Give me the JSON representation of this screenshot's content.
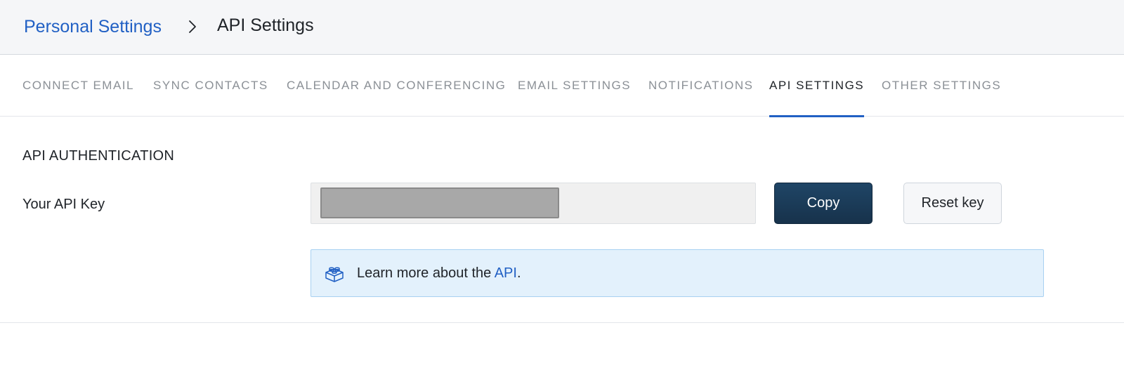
{
  "breadcrumb": {
    "parent": "Personal Settings",
    "separator_icon": "chevron-right-icon",
    "current": "API Settings"
  },
  "tabs": [
    {
      "label": "CONNECT EMAIL",
      "active": false
    },
    {
      "label": "SYNC CONTACTS",
      "active": false
    },
    {
      "label": "CALENDAR AND CONFERENCING",
      "active": false
    },
    {
      "label": "EMAIL SETTINGS",
      "active": false
    },
    {
      "label": "NOTIFICATIONS",
      "active": false
    },
    {
      "label": "API SETTINGS",
      "active": true
    },
    {
      "label": "OTHER SETTINGS",
      "active": false
    }
  ],
  "section": {
    "title": "API AUTHENTICATION",
    "api_key_label": "Your API Key",
    "api_key_value_state": "redacted",
    "copy_button": "Copy",
    "reset_button": "Reset key"
  },
  "info": {
    "icon": "lego-block-icon",
    "text_before": "Learn more about the ",
    "link_text": "API",
    "text_after": "."
  },
  "colors": {
    "accent": "#2160c4",
    "primary_button": "#1b3a57",
    "info_background": "#e3f1fc",
    "header_background": "#f5f6f8"
  }
}
